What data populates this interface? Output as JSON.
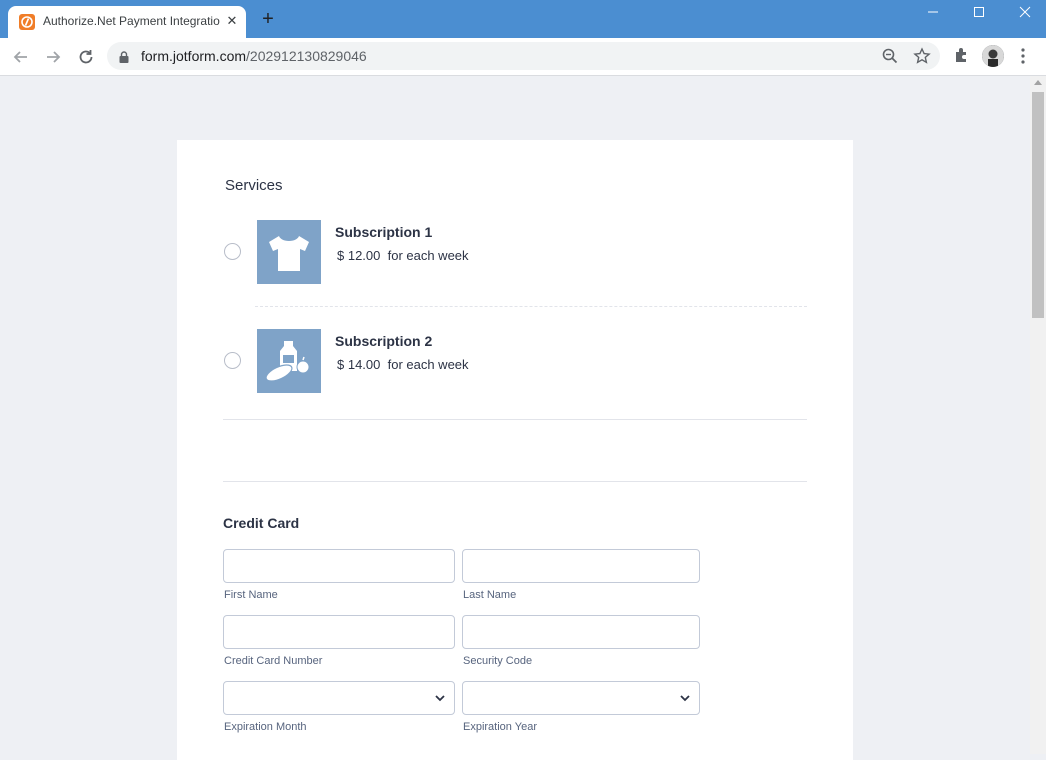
{
  "browser": {
    "tab_title": "Authorize.Net Payment Integratio",
    "tab_close": "✕",
    "new_tab": "+",
    "url_host": "form.jotform.com",
    "url_path": "/202912130829046"
  },
  "form": {
    "services_label": "Services",
    "products": [
      {
        "name": "Subscription 1",
        "price": "$ 12.00  for each week",
        "icon": "tshirt-icon"
      },
      {
        "name": "Subscription 2",
        "price": "$ 14.00  for each week",
        "icon": "groceries-icon"
      }
    ],
    "credit_card": {
      "heading": "Credit Card",
      "first_name": "First Name",
      "last_name": "Last Name",
      "card_number": "Credit Card Number",
      "security_code": "Security Code",
      "exp_month": "Expiration Month",
      "exp_year": "Expiration Year"
    }
  },
  "colors": {
    "tab_bar": "#4b8ed1",
    "thumbnail_bg": "#7fa3c8",
    "page_bg": "#eef0f4"
  }
}
